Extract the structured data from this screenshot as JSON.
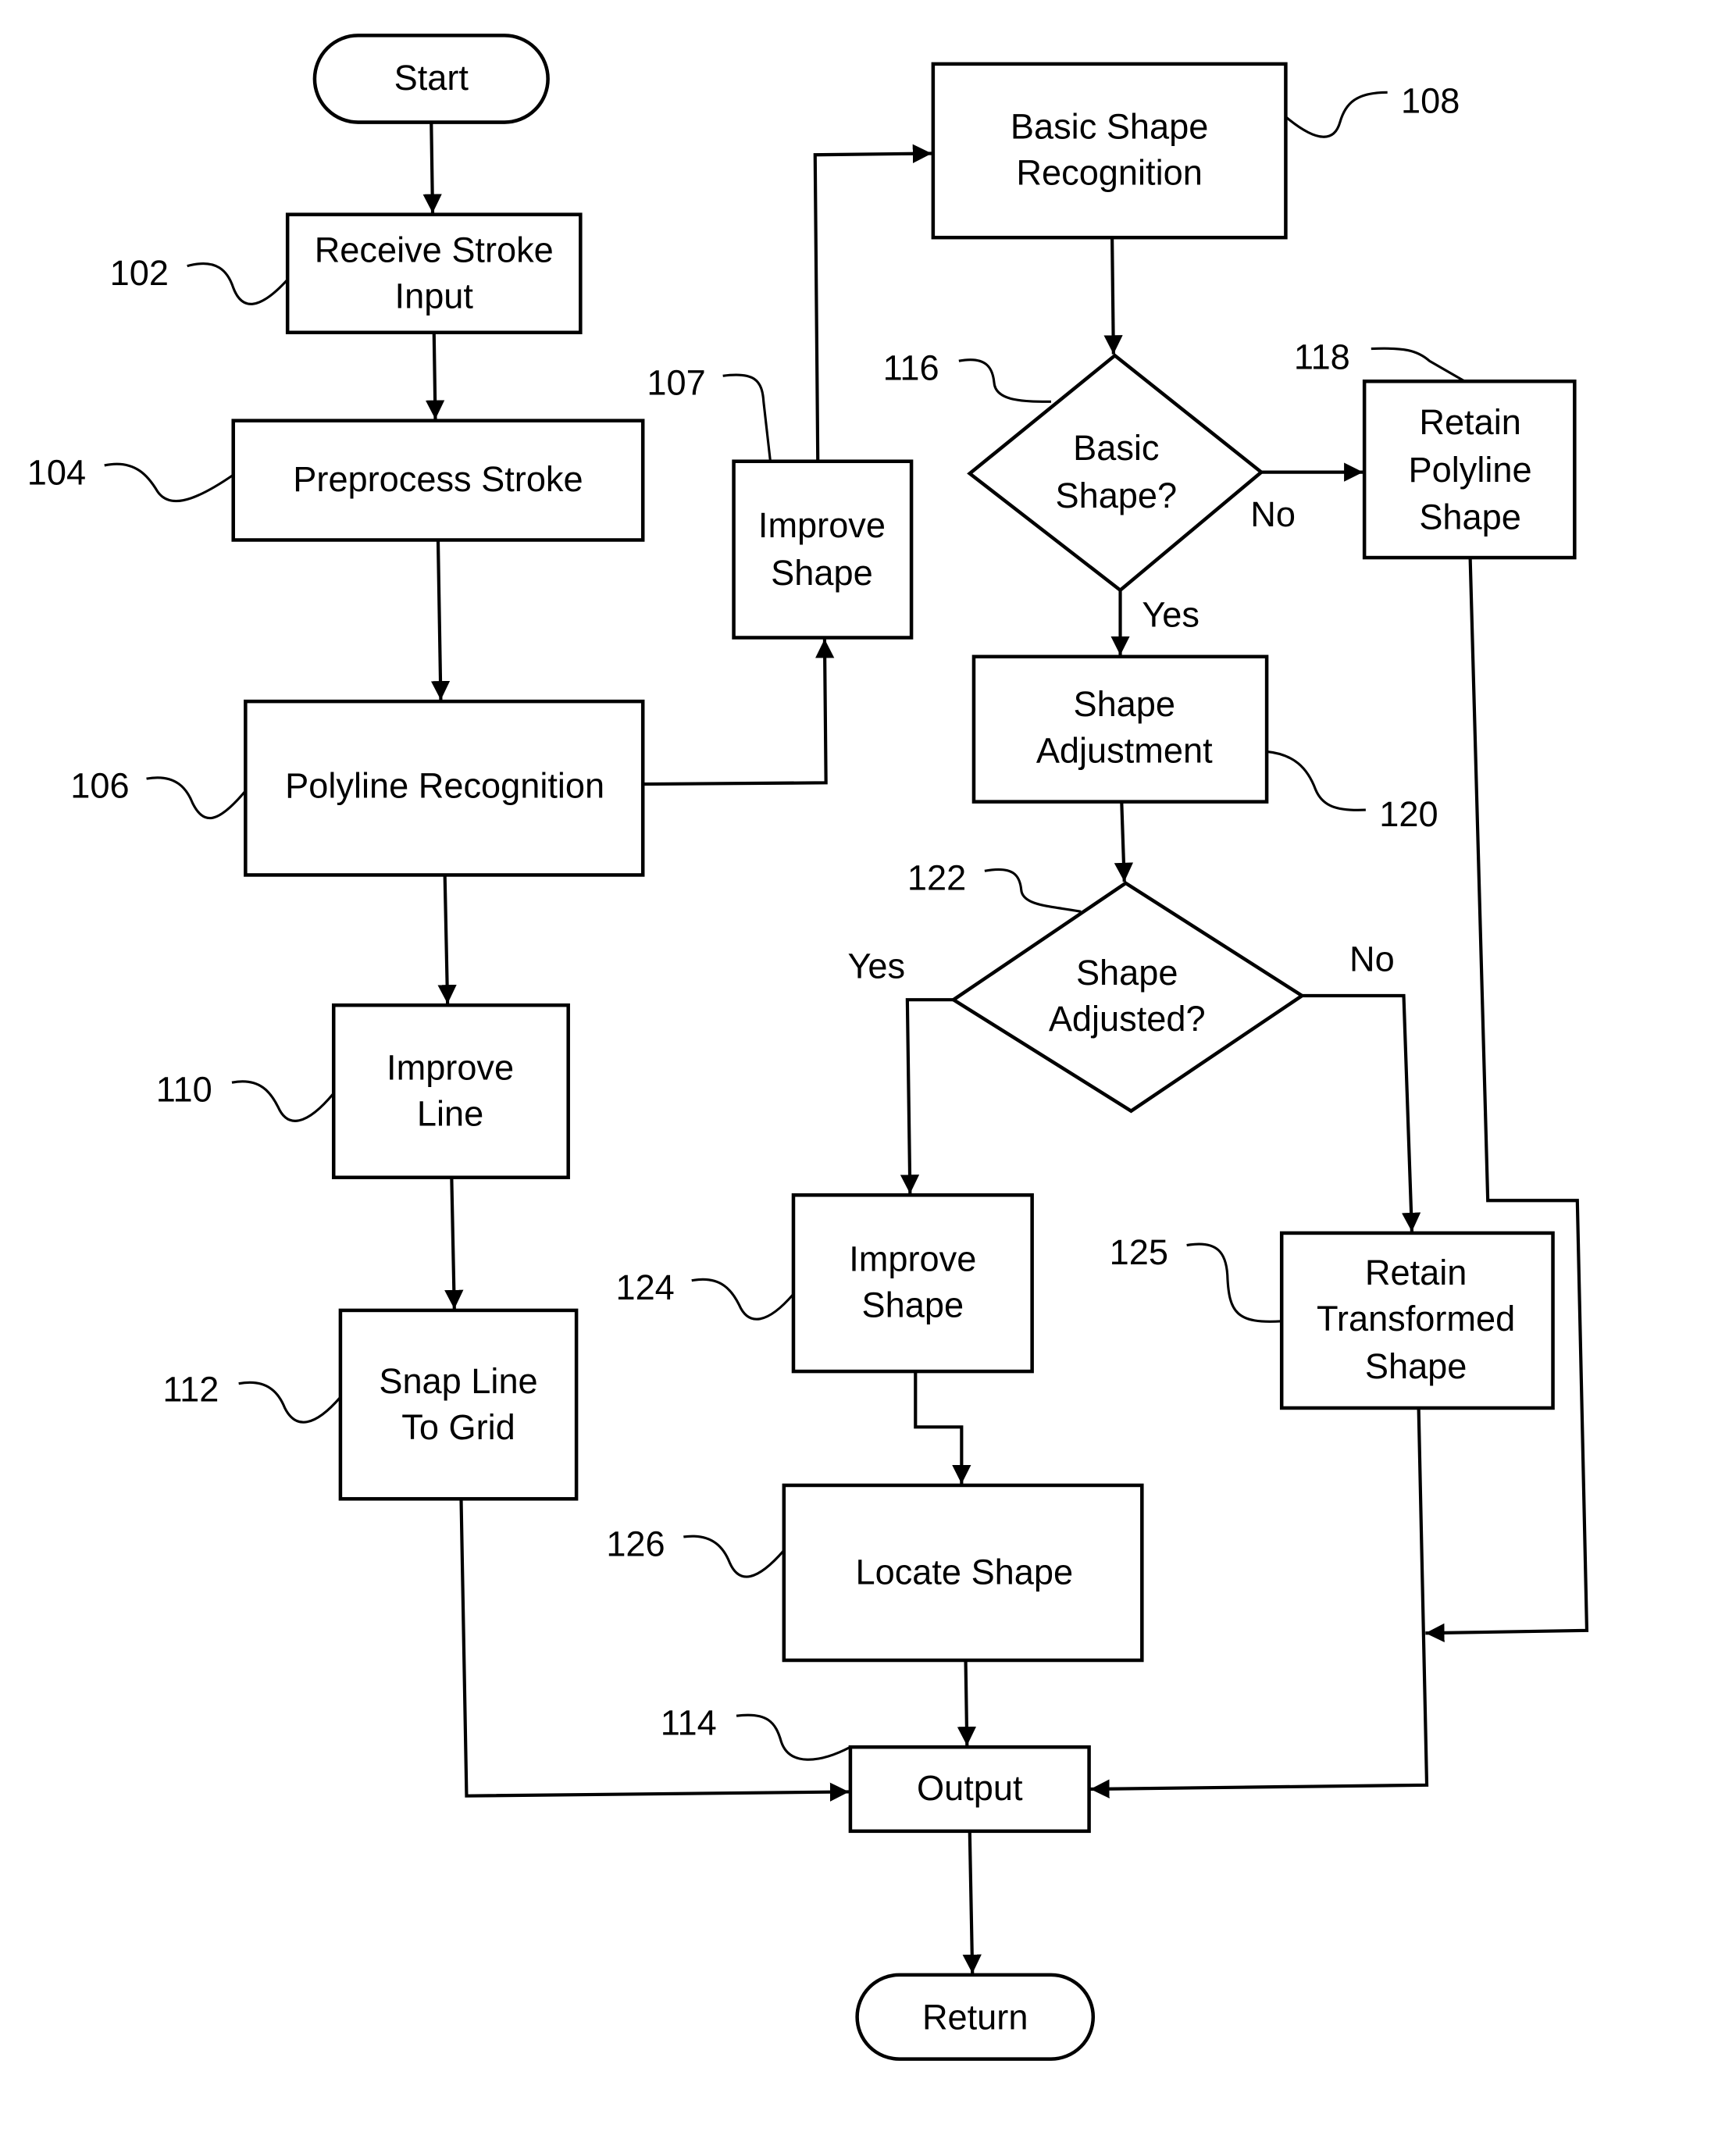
{
  "diagram": {
    "type": "flowchart",
    "terminals": {
      "start": "Start",
      "return": "Return"
    },
    "nodes": {
      "n102": {
        "ref": "102",
        "lines": [
          "Receive Stroke",
          "Input"
        ]
      },
      "n104": {
        "ref": "104",
        "lines": [
          "Preprocess Stroke"
        ]
      },
      "n106": {
        "ref": "106",
        "lines": [
          "Polyline Recognition"
        ]
      },
      "n107": {
        "ref": "107",
        "lines": [
          "Improve",
          "Shape"
        ]
      },
      "n108": {
        "ref": "108",
        "lines": [
          "Basic Shape",
          "Recognition"
        ]
      },
      "n110": {
        "ref": "110",
        "lines": [
          "Improve",
          "Line"
        ]
      },
      "n112": {
        "ref": "112",
        "lines": [
          "Snap Line",
          "To Grid"
        ]
      },
      "n114": {
        "ref": "114",
        "lines": [
          "Output"
        ]
      },
      "n116": {
        "ref": "116",
        "lines": [
          "Basic",
          "Shape?"
        ]
      },
      "n118": {
        "ref": "118",
        "lines": [
          "Retain",
          "Polyline",
          "Shape"
        ]
      },
      "n120": {
        "ref": "120",
        "lines": [
          "Shape",
          "Adjustment"
        ]
      },
      "n122": {
        "ref": "122",
        "lines": [
          "Shape",
          "Adjusted?"
        ]
      },
      "n124": {
        "ref": "124",
        "lines": [
          "Improve",
          "Shape"
        ]
      },
      "n125": {
        "ref": "125",
        "lines": [
          "Retain",
          "Transformed",
          "Shape"
        ]
      },
      "n126": {
        "ref": "126",
        "lines": [
          "Locate Shape"
        ]
      }
    },
    "branch_labels": {
      "d116_yes": "Yes",
      "d116_no": "No",
      "d122_yes": "Yes",
      "d122_no": "No"
    },
    "edges": [
      [
        "start",
        "102"
      ],
      [
        "102",
        "104"
      ],
      [
        "104",
        "106"
      ],
      [
        "106",
        "107"
      ],
      [
        "106",
        "110"
      ],
      [
        "107",
        "108"
      ],
      [
        "108",
        "116"
      ],
      [
        "116",
        "118",
        "No"
      ],
      [
        "116",
        "120",
        "Yes"
      ],
      [
        "120",
        "122"
      ],
      [
        "122",
        "124",
        "Yes"
      ],
      [
        "122",
        "125",
        "No"
      ],
      [
        "124",
        "126"
      ],
      [
        "126",
        "114"
      ],
      [
        "110",
        "112"
      ],
      [
        "112",
        "114"
      ],
      [
        "125",
        "114"
      ],
      [
        "118",
        "114"
      ],
      [
        "114",
        "return"
      ]
    ]
  }
}
